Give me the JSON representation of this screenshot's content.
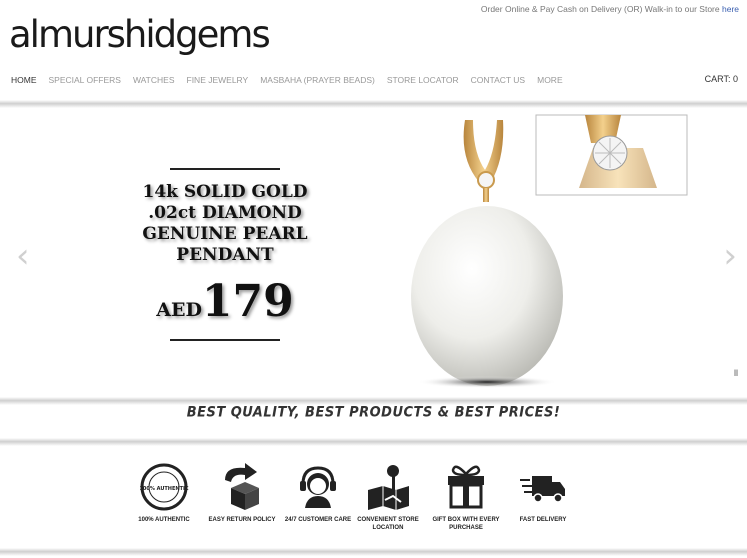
{
  "header": {
    "top_note": "Order Online & Pay Cash on Delivery (OR) Walk-in to our Store",
    "top_link": "here",
    "logo_text": "almurshidgems",
    "cart": "CART: 0"
  },
  "nav": {
    "items": [
      "HOME",
      "SPECIAL OFFERS",
      "WATCHES",
      "FINE JEWELRY",
      "MASBAHA (PRAYER BEADS)",
      "STORE LOCATOR",
      "CONTACT US",
      "MORE"
    ]
  },
  "slide": {
    "line1": "14k SOLID GOLD",
    "line2": ".02ct DIAMOND",
    "line3": "GENUINE PEARL",
    "line4": "PENDANT",
    "currency": "AED",
    "price": "179",
    "prev": "‹",
    "next": "›",
    "pager": "ll"
  },
  "tagline": "BEST QUALITY, BEST PRODUCTS & BEST PRICES!",
  "features": [
    {
      "label": "100% AUTHENTIC",
      "icon": "authentic-seal-icon"
    },
    {
      "label": "EASY RETURN POLICY",
      "icon": "return-box-icon"
    },
    {
      "label": "24/7 CUSTOMER CARE",
      "icon": "headset-icon"
    },
    {
      "label": "CONVENIENT STORE LOCATION",
      "icon": "map-pin-icon"
    },
    {
      "label": "GIFT BOX WITH EVERY PURCHASE",
      "icon": "gift-box-icon"
    },
    {
      "label": "FAST DELIVERY",
      "icon": "delivery-truck-icon"
    }
  ],
  "seal_text": "100% AUTHENTIC"
}
